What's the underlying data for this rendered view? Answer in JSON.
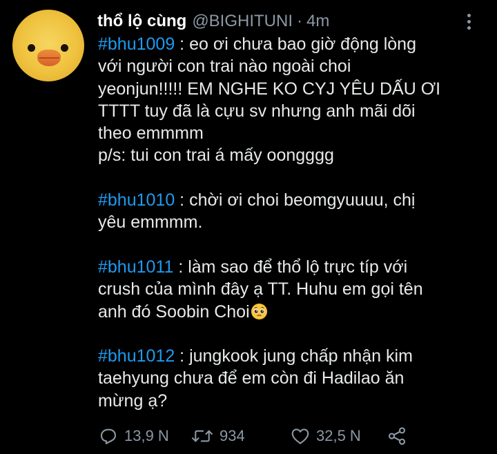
{
  "tweet": {
    "display_name": "thổ lộ cùng",
    "handle": "@BIGHITUNI",
    "separator": "·",
    "time": "4m",
    "body": {
      "p1": {
        "hashtag": "#bhu1009",
        "l1": " : eo ơi chưa bao giờ động lòng",
        "l2": "với người con trai nào ngoài choi",
        "l3": "yeonjun!!!!! EM NGHE KO CYJ YÊU DẤU ƠI",
        "l4": "TTTT tuy đã là cựu sv nhưng anh mãi dõi",
        "l5": "theo emmmm",
        "l6": "p/s: tui con trai á mấy oongggg"
      },
      "p2": {
        "hashtag": "#bhu1010",
        "l1": " : chời ơi choi beomgyuuuu, chị",
        "l2": "yêu emmmm."
      },
      "p3": {
        "hashtag": "#bhu1011",
        "l1": " : làm sao để thổ lộ trực típ với",
        "l2": "crush của mình đây ạ TT. Huhu em gọi tên",
        "l3": "anh đó Soobin Choi",
        "emoji": "pleading-face-emoji"
      },
      "p4": {
        "hashtag": "#bhu1012",
        "l1": " : jungkook jung chấp nhận kim",
        "l2": "taehyung chưa để em còn đi Hadilao ăn",
        "l3": "mừng ạ?"
      }
    },
    "actions": {
      "reply_count": "13,9 N",
      "retweet_count": "934",
      "like_count": "32,5 N"
    }
  },
  "colors": {
    "background": "#000000",
    "text": "#e7e9ea",
    "secondary": "#8b98a5",
    "hashtag": "#1d9bf0"
  },
  "icons": {
    "reply": "reply-icon",
    "retweet": "retweet-icon",
    "like": "heart-icon",
    "share": "share-icon",
    "more": "more-options-icon"
  }
}
